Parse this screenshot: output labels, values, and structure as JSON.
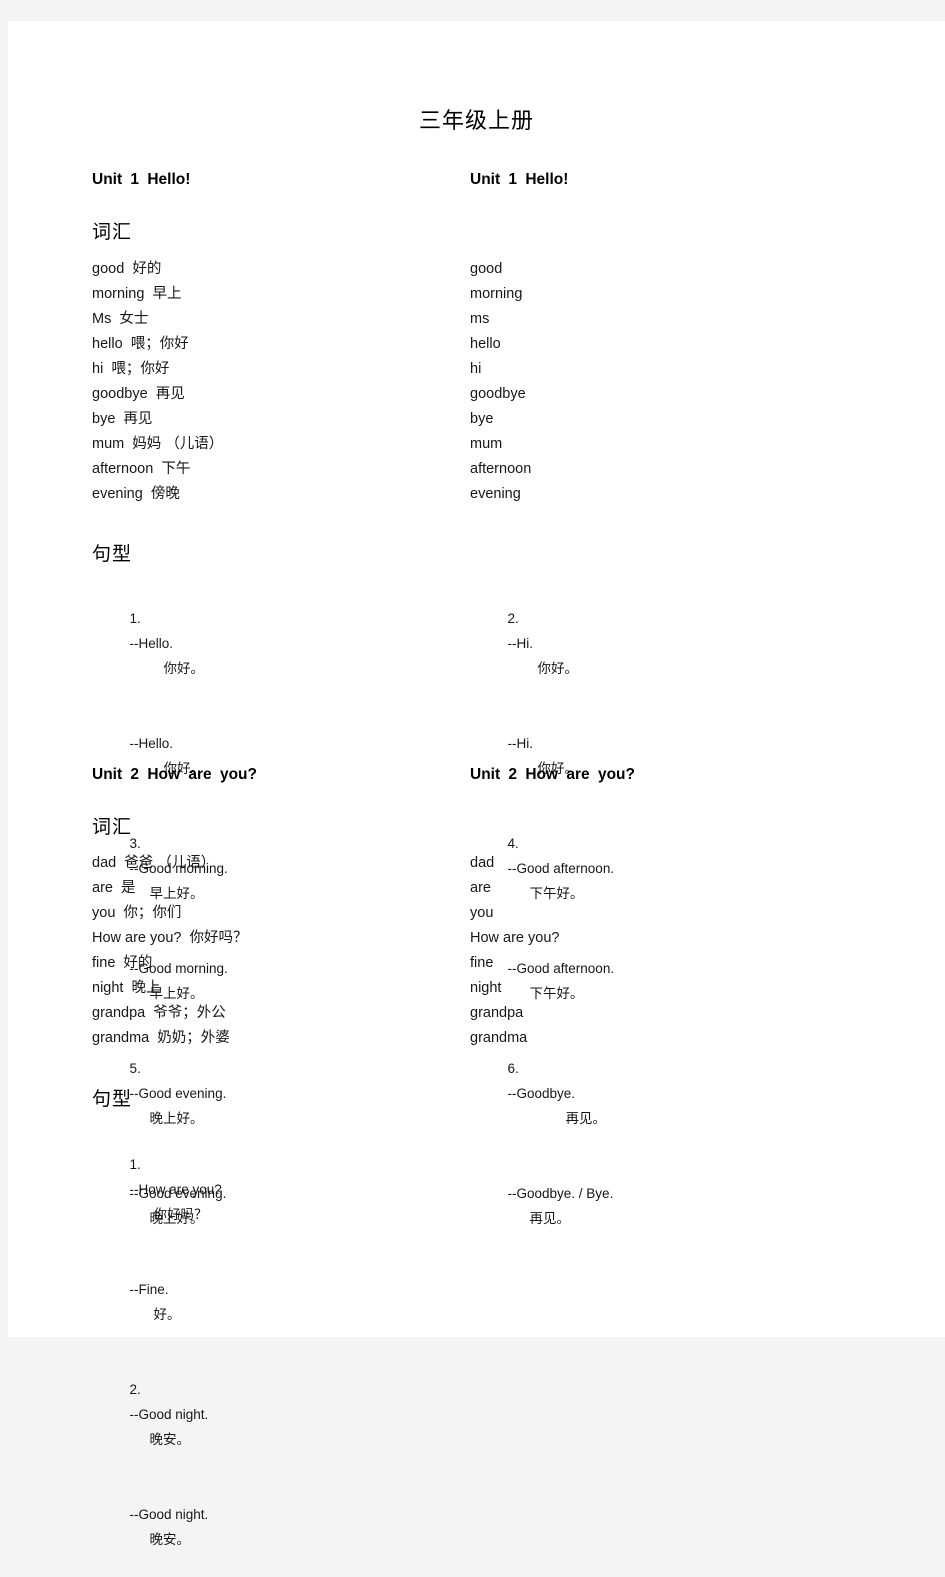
{
  "document": {
    "title": "三年级上册"
  },
  "units": [
    {
      "id": "unit-1",
      "heading": "Unit 1 Hello!",
      "vocab_heading": "词汇",
      "pattern_heading": "句型",
      "vocab_left": [
        "good  好的",
        "morning  早上",
        "Ms  女士",
        "hello  喂；你好",
        "hi  喂；你好",
        "goodbye  再见",
        "bye  再见",
        "mum  妈妈 （儿语）",
        "afternoon  下午",
        "evening  傍晚"
      ],
      "vocab_right": [
        "good",
        "morning",
        "ms",
        "hello",
        "hi",
        "goodbye",
        "bye",
        "mum",
        "afternoon",
        "evening"
      ],
      "patterns_left": [
        {
          "num": "1.",
          "prompt": "--Hello.",
          "prompt_cn": "你好。",
          "reply": "--Hello.",
          "reply_cn": "你好。"
        },
        {
          "num": "3.",
          "prompt": "--Good morning.",
          "prompt_cn": "早上好。",
          "reply": "--Good morning.",
          "reply_cn": "早上好。"
        },
        {
          "num": "5.",
          "prompt": "--Good evening.",
          "prompt_cn": "晚上好。",
          "reply": "--Good evening.",
          "reply_cn": "晚上好。"
        }
      ],
      "patterns_right": [
        {
          "num": "2.",
          "prompt": "--Hi.",
          "prompt_cn": "你好。",
          "reply": "--Hi.",
          "reply_cn": "你好。"
        },
        {
          "num": "4.",
          "prompt": "--Good afternoon.",
          "prompt_cn": "下午好。",
          "reply": "--Good afternoon.",
          "reply_cn": "下午好。"
        },
        {
          "num": "6.",
          "prompt": "--Goodbye.",
          "prompt_cn": "再见。",
          "reply": "--Goodbye. / Bye.",
          "reply_cn": "再见。"
        }
      ]
    },
    {
      "id": "unit-2",
      "heading": "Unit 2 How are you?",
      "vocab_heading": "词汇",
      "pattern_heading": "句型",
      "vocab_left": [
        "dad  爸爸 （儿语）",
        "are  是",
        "you  你；你们",
        "How are you?  你好吗？",
        "fine  好的",
        "night  晚上",
        "grandpa  爷爷；外公",
        "grandma  奶奶；外婆"
      ],
      "vocab_right": [
        "dad",
        "are",
        "you",
        "How are you?",
        "fine",
        "night",
        "grandpa",
        "grandma"
      ],
      "patterns_left": [
        {
          "num": "1.",
          "prompt": "--How are you?",
          "prompt_cn": "你好吗？",
          "reply": "--Fine.",
          "reply_cn": "好。"
        },
        {
          "num": "2.",
          "prompt": "--Good night.",
          "prompt_cn": "晚安。",
          "reply": "--Good night.",
          "reply_cn": "晚安。"
        }
      ],
      "patterns_right": []
    }
  ]
}
